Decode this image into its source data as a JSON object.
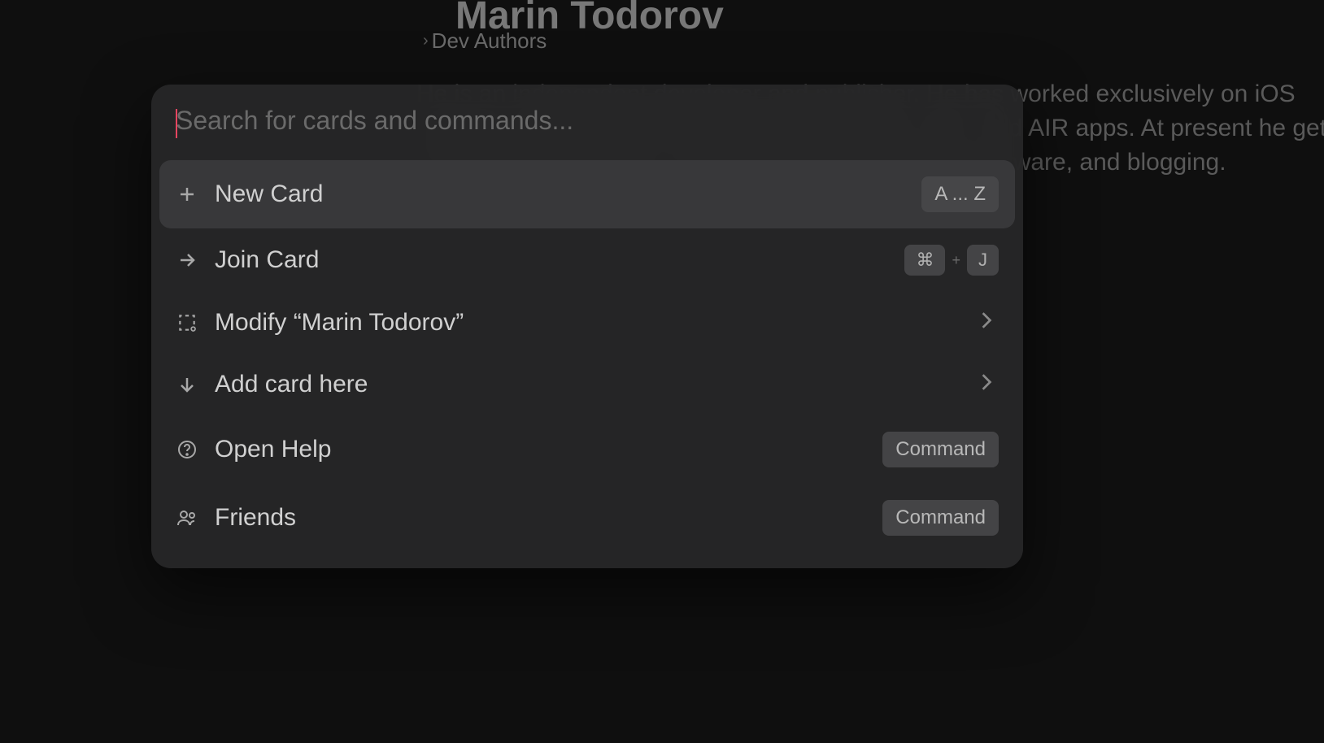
{
  "background": {
    "title": "Marin Todorov",
    "breadcrumb": "Dev Authors",
    "paragraph": "He is an independent developer and publisher. He has worked exclusively on iOS projects, but has also developed Adobe Flash, Flex, and AIR apps. At present he gets by writing mobile apps, writing books about making software, and blogging."
  },
  "palette": {
    "search_placeholder": "Search for cards and commands...",
    "items": [
      {
        "label": "New Card",
        "shortcut_type": "text",
        "shortcut": "A ... Z",
        "selected": true
      },
      {
        "label": "Join Card",
        "shortcut_type": "keys",
        "key1": "⌘",
        "key2": "J"
      },
      {
        "label": "Modify “Marin Todorov”",
        "shortcut_type": "chevron"
      },
      {
        "label": "Add card here",
        "shortcut_type": "chevron"
      },
      {
        "label": "Open Help",
        "shortcut_type": "badge",
        "badge": "Command"
      },
      {
        "label": "Friends",
        "shortcut_type": "badge",
        "badge": "Command"
      }
    ]
  }
}
